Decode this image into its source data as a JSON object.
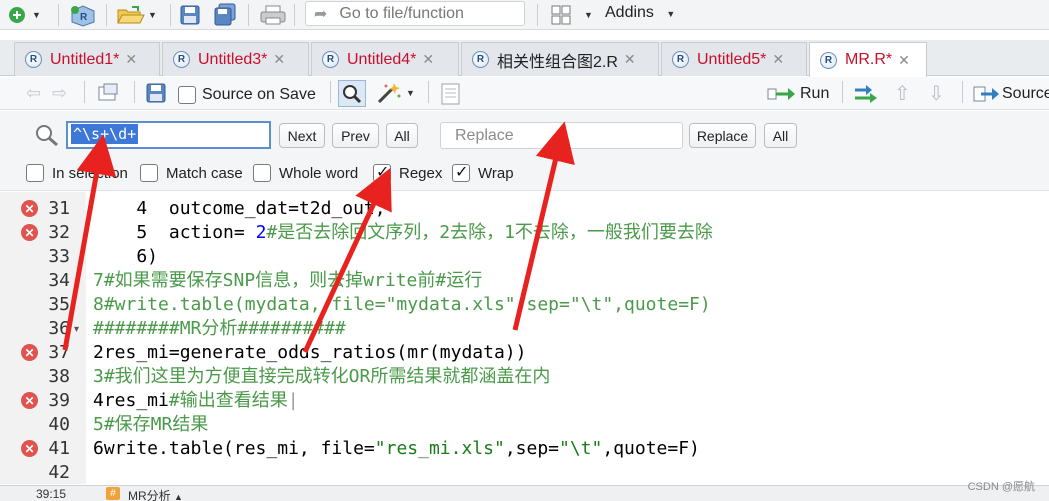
{
  "toolbar": {
    "goto_placeholder": "Go to file/function",
    "addins_label": "Addins"
  },
  "tabs": [
    {
      "label": "Untitled1*",
      "dirty": true
    },
    {
      "label": "Untitled3*",
      "dirty": true
    },
    {
      "label": "Untitled4*",
      "dirty": true
    },
    {
      "label": "相关性组合图2.R",
      "dirty": false
    },
    {
      "label": "Untitled5*",
      "dirty": true
    },
    {
      "label": "MR.R*",
      "dirty": true
    }
  ],
  "editor_toolbar": {
    "source_on_save": "Source on Save",
    "run": "Run",
    "source": "Source"
  },
  "find": {
    "query": "^\\s+\\d+",
    "next": "Next",
    "prev": "Prev",
    "all": "All",
    "replace_placeholder": "Replace",
    "replace": "Replace",
    "replace_all": "All"
  },
  "options": {
    "in_selection": {
      "label": "In selection",
      "checked": false
    },
    "match_case": {
      "label": "Match case",
      "checked": false
    },
    "whole_word": {
      "label": "Whole word",
      "checked": false
    },
    "regex": {
      "label": "Regex",
      "checked": true
    },
    "wrap": {
      "label": "Wrap",
      "checked": true
    }
  },
  "code_lines": [
    {
      "n": "31",
      "error": true
    },
    {
      "n": "32",
      "error": true
    },
    {
      "n": "33",
      "error": false
    },
    {
      "n": "34",
      "error": false
    },
    {
      "n": "35",
      "error": false
    },
    {
      "n": "36",
      "error": false,
      "fold": true
    },
    {
      "n": "37",
      "error": true
    },
    {
      "n": "38",
      "error": false
    },
    {
      "n": "39",
      "error": true
    },
    {
      "n": "40",
      "error": false
    },
    {
      "n": "41",
      "error": true
    },
    {
      "n": "42",
      "error": false
    }
  ],
  "code": {
    "l31_a": "    4  ",
    "l31_b": "outcome_dat=t2d_out,",
    "l32_a": "    5  ",
    "l32_b": "action= ",
    "l32_num": "2",
    "l32_cm": "#是否去除回文序列，2去除，1不去除，一般我们要去除",
    "l33": "    6)",
    "l34": "7#如果需要保存SNP信息，则去掉write前#运行",
    "l35": "8#write.table(mydata, file=\"mydata.xls\",sep=\"\\t\",quote=F)",
    "l36": "########MR分析##########",
    "l37": "2res_mi=generate_odds_ratios(mr(mydata))",
    "l38": "3#我们这里为方便直接完成转化OR所需结果就都涵盖在内",
    "l39_a": "4res_mi",
    "l39_cm": "#输出查看结果",
    "l40": "5#保存MR结果",
    "l41_a": "6write.table(res_mi, file=",
    "l41_s1": "\"res_mi.xls\"",
    "l41_b": ",sep=",
    "l41_s2": "\"\\t\"",
    "l41_c": ",quote=F)"
  },
  "status": {
    "position": "39:15",
    "section": "MR分析"
  },
  "watermark": "CSDN @愿航",
  "colors": {
    "accent": "#3d78d8",
    "dirty_tab": "#c8102e",
    "error": "#e0524e",
    "annotation_arrow": "#e8231f"
  }
}
